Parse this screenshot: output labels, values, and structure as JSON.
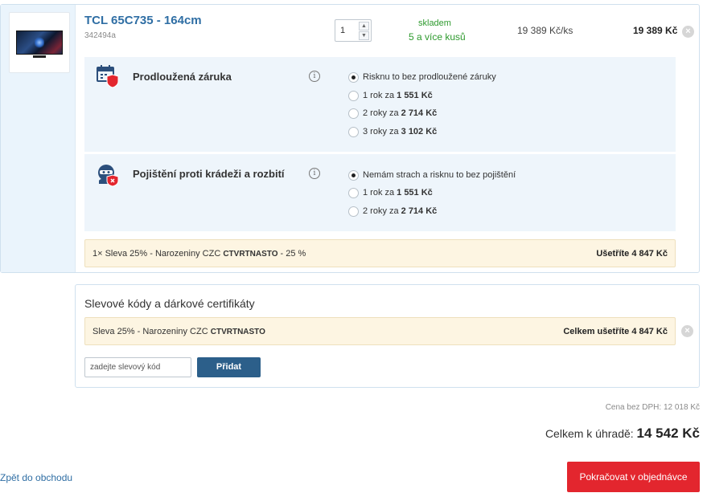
{
  "product": {
    "title": "TCL 65C735 - 164cm",
    "code": "342494a",
    "quantity": "1",
    "stock_status": "skladem",
    "stock_amount": "5 a více kusů",
    "unit_price": "19 389 Kč/ks",
    "total_price": "19 389 Kč"
  },
  "warranty": {
    "title": "Prodloužená záruka",
    "options": [
      {
        "text": "Risknu to bez prodloužené záruky",
        "price": "",
        "selected": true
      },
      {
        "text": "1 rok za",
        "price": "1 551 Kč",
        "selected": false
      },
      {
        "text": "2 roky za",
        "price": "2 714 Kč",
        "selected": false
      },
      {
        "text": "3 roky za",
        "price": "3 102 Kč",
        "selected": false
      }
    ]
  },
  "insurance": {
    "title": "Pojištění proti krádeži a rozbití",
    "options": [
      {
        "text": "Nemám strach a risknu to bez pojištění",
        "price": "",
        "selected": true
      },
      {
        "text": "1 rok za",
        "price": "1 551 Kč",
        "selected": false
      },
      {
        "text": "2 roky za",
        "price": "2 714 Kč",
        "selected": false
      }
    ]
  },
  "item_discount": {
    "prefix": "1× Sleva 25% - Narozeniny CZC",
    "code": "CTVRTNASTO",
    "suffix": "- 25 %",
    "savings": "Ušetříte 4 847 Kč"
  },
  "coupons": {
    "title": "Slevové kódy a dárkové certifikáty",
    "applied_prefix": "Sleva 25% - Narozeniny CZC",
    "applied_code": "CTVRTNASTO",
    "applied_savings": "Celkem ušetříte 4 847 Kč",
    "input_placeholder": "zadejte slevový kód",
    "add_label": "Přidat"
  },
  "summary": {
    "net_price": "Cena bez DPH: 12 018 Kč",
    "total_label": "Celkem k úhradě:",
    "total_value": "14 542 Kč"
  },
  "nav": {
    "back_label": "Zpět do obchodu",
    "continue_label": "Pokračovat v objednávce"
  },
  "colors": {
    "link": "#2f6ea4",
    "stock": "#2e9a2e",
    "primary_button": "#e3262e",
    "secondary_button": "#2c5f8a",
    "discount_bg": "#fdf5e2",
    "panel_bg": "#eef5fb"
  },
  "icons": [
    "calendar-shield-icon",
    "thief-shield-icon",
    "info-icon",
    "close-icon"
  ]
}
